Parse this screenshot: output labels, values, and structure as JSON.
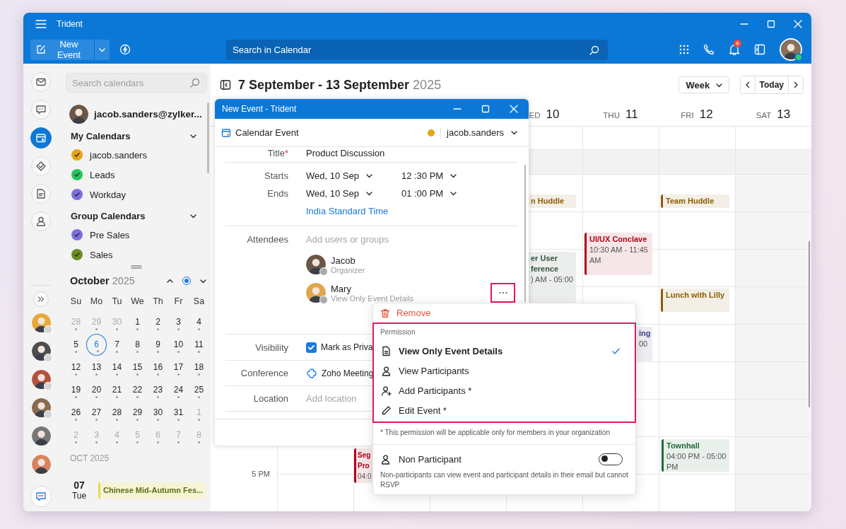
{
  "window": {
    "title": "Trident"
  },
  "toolbar": {
    "new_event": "New Event",
    "search": {
      "placeholder": "Search in Calendar"
    },
    "notification_count": "9",
    "online": true
  },
  "rail": {
    "apps": [
      {
        "kind": "mail",
        "selected": false
      },
      {
        "kind": "chat",
        "selected": false
      },
      {
        "kind": "calendar",
        "selected": true
      },
      {
        "kind": "tasks",
        "selected": false
      },
      {
        "kind": "notes",
        "selected": false
      },
      {
        "kind": "contacts",
        "selected": false
      }
    ],
    "people": [
      {
        "kind": "picture",
        "away": true
      },
      {
        "kind": "picture",
        "away": true
      },
      {
        "kind": "picture",
        "away": true
      },
      {
        "kind": "picture",
        "away": true
      },
      {
        "kind": "picture",
        "away": false
      },
      {
        "kind": "picture",
        "away": false
      }
    ]
  },
  "sidebar": {
    "search": {
      "placeholder": "Search calendars"
    },
    "account": "jacob.sanders@zylker...",
    "groups": [
      {
        "title": "My Calendars",
        "expanded": true,
        "items": [
          {
            "name": "jacob.sanders",
            "color": "#e8a317",
            "checked": true
          },
          {
            "name": "Leads",
            "color": "#22c55e",
            "checked": true
          },
          {
            "name": "Workday",
            "color": "#7c6fe0",
            "checked": true
          }
        ]
      },
      {
        "title": "Group Calendars",
        "expanded": true,
        "items": [
          {
            "name": "Pre Sales",
            "color": "#7c6fe0",
            "checked": true
          },
          {
            "name": "Sales",
            "color": "#6b8e23",
            "checked": true
          }
        ]
      }
    ]
  },
  "mini_calendar": {
    "month": "October",
    "year": "2025",
    "weekdays": [
      "Su",
      "Mo",
      "Tu",
      "We",
      "Th",
      "Fr",
      "Sa"
    ],
    "weeks": [
      [
        {
          "d": "28",
          "muted": true,
          "selected": false
        },
        {
          "d": "29",
          "muted": true,
          "selected": false
        },
        {
          "d": "30",
          "muted": true,
          "selected": false
        },
        {
          "d": "1",
          "muted": false,
          "selected": false
        },
        {
          "d": "2",
          "muted": false,
          "selected": false
        },
        {
          "d": "3",
          "muted": false,
          "selected": false
        },
        {
          "d": "4",
          "muted": false,
          "selected": false
        }
      ],
      [
        {
          "d": "5",
          "muted": false,
          "selected": false
        },
        {
          "d": "6",
          "muted": false,
          "selected": true
        },
        {
          "d": "7",
          "muted": false,
          "selected": false
        },
        {
          "d": "8",
          "muted": false,
          "selected": false
        },
        {
          "d": "9",
          "muted": false,
          "selected": false
        },
        {
          "d": "10",
          "muted": false,
          "selected": false
        },
        {
          "d": "11",
          "muted": false,
          "selected": false
        }
      ],
      [
        {
          "d": "12",
          "muted": false,
          "selected": false
        },
        {
          "d": "13",
          "muted": false,
          "selected": false
        },
        {
          "d": "14",
          "muted": false,
          "selected": false
        },
        {
          "d": "15",
          "muted": false,
          "selected": false
        },
        {
          "d": "16",
          "muted": false,
          "selected": false
        },
        {
          "d": "17",
          "muted": false,
          "selected": false
        },
        {
          "d": "18",
          "muted": false,
          "selected": false
        }
      ],
      [
        {
          "d": "19",
          "muted": false,
          "selected": false
        },
        {
          "d": "20",
          "muted": false,
          "selected": false
        },
        {
          "d": "21",
          "muted": false,
          "selected": false
        },
        {
          "d": "22",
          "muted": false,
          "selected": false
        },
        {
          "d": "23",
          "muted": false,
          "selected": false
        },
        {
          "d": "24",
          "muted": false,
          "selected": false
        },
        {
          "d": "25",
          "muted": false,
          "selected": false
        }
      ],
      [
        {
          "d": "26",
          "muted": false,
          "selected": false
        },
        {
          "d": "27",
          "muted": false,
          "selected": false
        },
        {
          "d": "28",
          "muted": false,
          "selected": false
        },
        {
          "d": "29",
          "muted": false,
          "selected": false
        },
        {
          "d": "30",
          "muted": false,
          "selected": false
        },
        {
          "d": "31",
          "muted": false,
          "selected": false
        },
        {
          "d": "1",
          "muted": true,
          "selected": false
        }
      ],
      [
        {
          "d": "2",
          "muted": true,
          "selected": false
        },
        {
          "d": "3",
          "muted": true,
          "selected": false
        },
        {
          "d": "4",
          "muted": true,
          "selected": false
        },
        {
          "d": "5",
          "muted": true,
          "selected": false
        },
        {
          "d": "6",
          "muted": true,
          "selected": false
        },
        {
          "d": "7",
          "muted": true,
          "selected": false
        },
        {
          "d": "8",
          "muted": true,
          "selected": false
        }
      ]
    ]
  },
  "agenda": {
    "heading": "OCT 2025",
    "days": [
      {
        "date": "07",
        "weekday": "Tue",
        "events": [
          {
            "title": "Chinese Mid-Autumn Fes...",
            "color": "#e8d84a"
          }
        ]
      }
    ]
  },
  "calendar": {
    "range": "7 September - 13 September",
    "year": "2025",
    "view": "Week",
    "today": "Today",
    "days": [
      {
        "weekday": "ED",
        "date": "10"
      },
      {
        "weekday": "THU",
        "date": "11"
      },
      {
        "weekday": "FRI",
        "date": "12"
      },
      {
        "weekday": "SAT",
        "date": "13"
      }
    ],
    "times": [
      "5 PM"
    ],
    "events": [
      {
        "title": "n Huddle",
        "color": "#8a5d00"
      },
      {
        "title": "Team Huddle",
        "color": "#8a5d00"
      },
      {
        "title": "UI/UX Conclave",
        "time": "10:30 AM - 11:45 AM",
        "color": "#b00016"
      },
      {
        "title": "er User ference",
        "time": ") AM - 05:00",
        "color": "#34513f"
      },
      {
        "title": "Lunch with Lilly",
        "color": "#8a5d00"
      },
      {
        "title": "ing",
        "time": "00",
        "color": "#3f4380"
      },
      {
        "title": "Townhall",
        "time": "04:00 PM - 05:00 PM",
        "color": "#1f6b3a"
      },
      {
        "title": "Seg Pro",
        "time": "04:0",
        "color": "#b00016"
      }
    ]
  },
  "dialog": {
    "title": "New Event - Trident",
    "event_type": "Calendar Event",
    "calendar": {
      "name": "jacob.sanders",
      "color": "#e8a317"
    },
    "title_field": {
      "label": "Title",
      "required_mark": "*",
      "value": "Product Discussion"
    },
    "starts": {
      "label": "Starts",
      "date": "Wed, 10 Sep",
      "time": "12 :30 PM"
    },
    "ends": {
      "label": "Ends",
      "date": "Wed, 10 Sep",
      "time": "01 :00 PM"
    },
    "timezone": "India Standard Time",
    "attendees": {
      "label": "Attendees",
      "placeholder": "Add users or groups",
      "people": [
        {
          "name": "Jacob",
          "role": "Organizer"
        },
        {
          "name": "Mary",
          "role": "View Only Event Details",
          "highlighted": true
        }
      ]
    },
    "visibility": {
      "label": "Visibility",
      "option": "Mark as Priva",
      "checked": true
    },
    "conference": {
      "label": "Conference",
      "value": "Zoho Meeting"
    },
    "location": {
      "label": "Location",
      "placeholder": "Add location"
    }
  },
  "attendee_menu": {
    "remove": "Remove",
    "permission": {
      "heading": "Permission",
      "highlighted": true,
      "options": [
        {
          "label": "View Only Event Details",
          "kind": "document",
          "selected": true
        },
        {
          "label": "View Participants",
          "kind": "person",
          "selected": false
        },
        {
          "label": "Add Participants *",
          "kind": "person-add",
          "selected": false
        },
        {
          "label": "Edit Event *",
          "kind": "pencil",
          "selected": false
        }
      ]
    },
    "note": "* This permission will be applicable only for members in your organization",
    "non_participant": {
      "label": "Non Participant",
      "on": false,
      "description": "Non-participants can view event and participant details in their email but cannot RSVP"
    }
  }
}
